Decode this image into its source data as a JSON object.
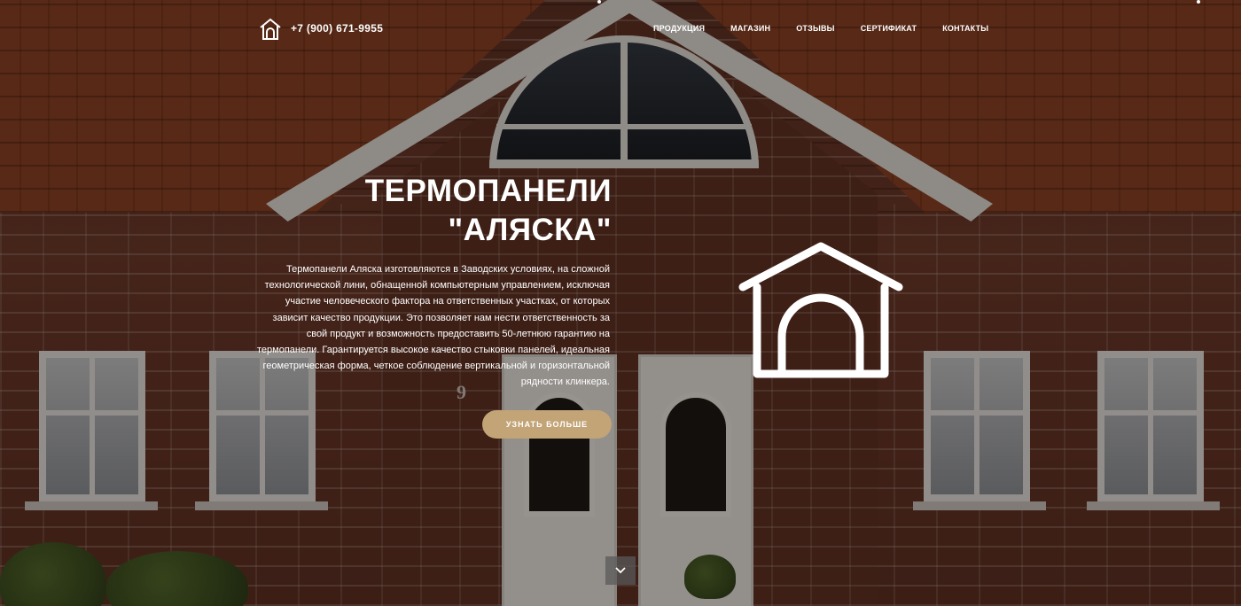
{
  "header": {
    "phone": "+7 (900) 671-9955",
    "logo_icon": "house-outline-icon",
    "nav": [
      {
        "label": "ПРОДУКЦИЯ"
      },
      {
        "label": "МАГАЗИН"
      },
      {
        "label": "ОТЗЫВЫ"
      },
      {
        "label": "СЕРТИФИКАТ"
      },
      {
        "label": "КОНТАКТЫ"
      }
    ]
  },
  "hero": {
    "title_line1": "ТЕРМОПАНЕЛИ",
    "title_line2": "\"АЛЯСКА\"",
    "description": "Термопанели Аляска изготовляются в Заводских условиях, на сложной технологической лини, обнащенной компьютерным управлением, исключая участие человеческого фактора на ответственных участках, от которых зависит качество продукции. Это позволяет нам нести ответственность за свой продукт и возможность предоставить 50-летнюю гарантию на термопанели. Гарантируется высокое качество стыковки панелей, идеальная геометрическая форма, четкое соблюдение вертикальной и горизонтальной рядности клинкера.",
    "cta_label": "УЗНАТЬ БОЛЬШЕ",
    "house_icon": "house-outline-icon",
    "scroll_icon": "chevron-down-icon",
    "house_number": "9"
  },
  "colors": {
    "accent": "#c2a477",
    "text": "#ffffff",
    "overlay": "rgba(20,12,8,0.42)"
  }
}
